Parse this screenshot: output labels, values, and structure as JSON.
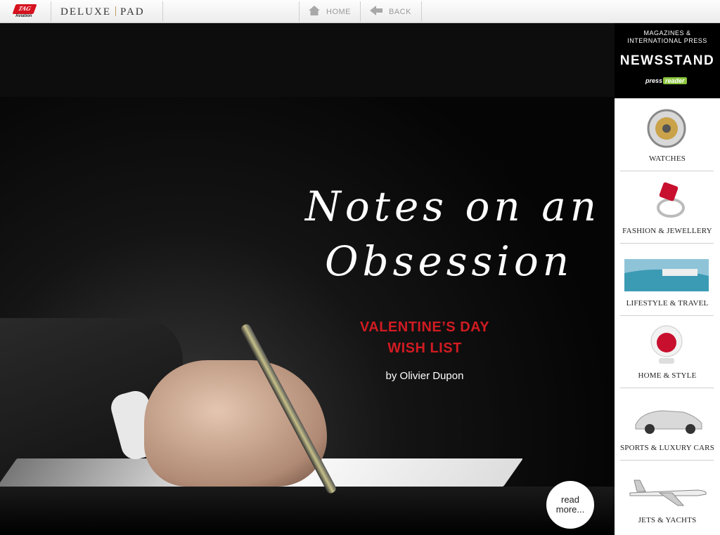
{
  "topbar": {
    "logo_mark": "TAG",
    "logo_sub": "Aviation",
    "brand_left": "DELUXE",
    "brand_right": "PAD",
    "home_label": "HOME",
    "back_label": "BACK"
  },
  "hero": {
    "script_line1": "Notes on an",
    "script_line2": "Obsession",
    "subtitle_line1": "VALENTINE’S DAY",
    "subtitle_line2": "WISH LIST",
    "byline": "by Olivier Dupon",
    "readmore_line1": "read",
    "readmore_line2": "more..."
  },
  "sidebar": {
    "newsstand_top_line1": "MAGAZINES &",
    "newsstand_top_line2": "INTERNATIONAL PRESS",
    "newsstand_title": "NEWSSTAND",
    "pressreader_a": "press",
    "pressreader_b": "reader",
    "categories": [
      {
        "label": "WATCHES",
        "icon": "watch-icon"
      },
      {
        "label": "FASHION & JEWELLERY",
        "icon": "ring-icon"
      },
      {
        "label": "LIFESTYLE & TRAVEL",
        "icon": "resort-icon"
      },
      {
        "label": "HOME & STYLE",
        "icon": "chair-icon"
      },
      {
        "label": "SPORTS & LUXURY CARS",
        "icon": "car-icon"
      },
      {
        "label": "JETS & YACHTS",
        "icon": "jet-icon"
      }
    ]
  },
  "colors": {
    "accent_red": "#d11b22",
    "pressreader_green": "#8cc63f"
  }
}
